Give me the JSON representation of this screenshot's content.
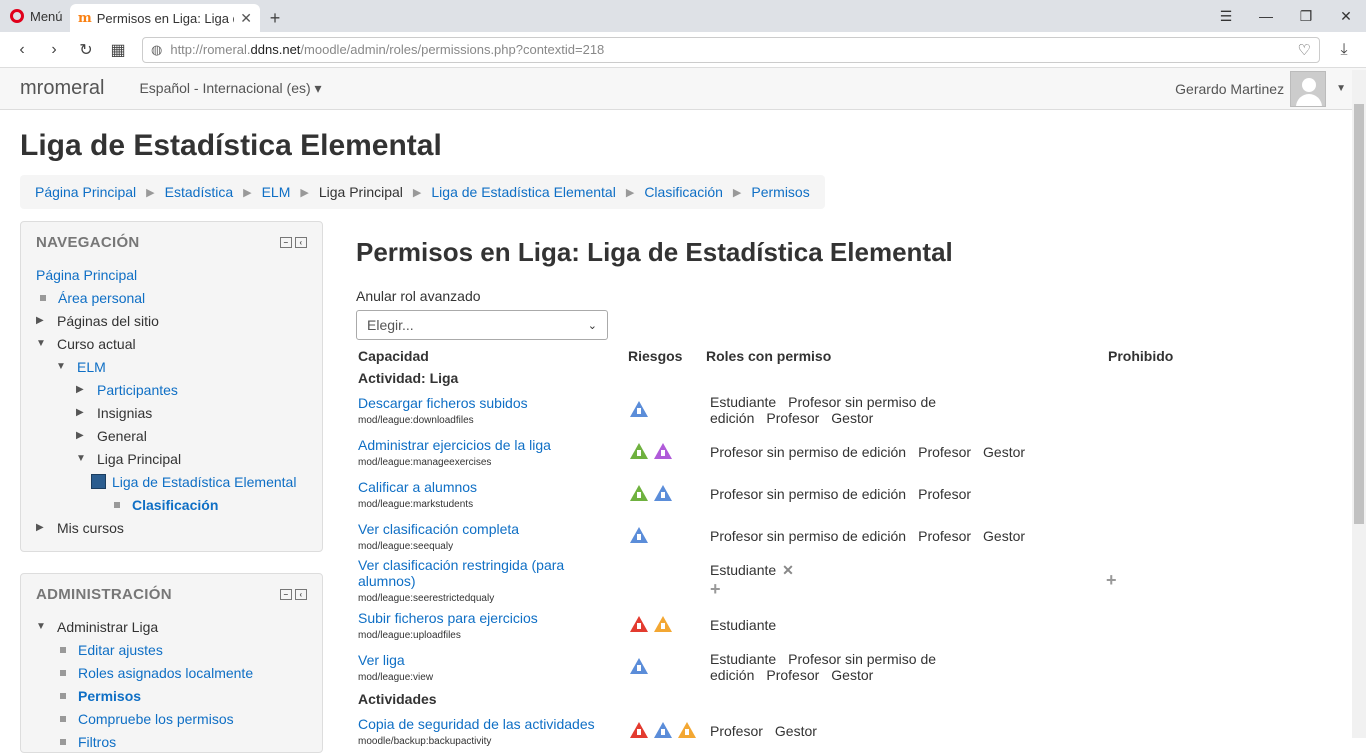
{
  "browser": {
    "menu_label": "Menú",
    "tab_title": "Permisos en Liga: Liga de E",
    "url_prefix": "http://romeral.",
    "url_domain": "ddns.net",
    "url_path": "/moodle/admin/roles/permissions.php?contextid=218"
  },
  "navbar": {
    "brand": "mromeral",
    "language": "Español - Internacional (es)",
    "user_name": "Gerardo Martinez"
  },
  "page_title": "Liga de Estadística Elemental",
  "breadcrumb": [
    "Página Principal",
    "Estadística",
    "ELM",
    "Liga Principal",
    "Liga de Estadística Elemental",
    "Clasificación",
    "Permisos"
  ],
  "navigation": {
    "title": "NAVEGACIÓN",
    "items": [
      "Página Principal",
      "Área personal",
      "Páginas del sitio",
      "Curso actual",
      "ELM",
      "Participantes",
      "Insignias",
      "General",
      "Liga Principal",
      "Liga de Estadística Elemental",
      "Clasificación",
      "Mis cursos"
    ]
  },
  "administration": {
    "title": "ADMINISTRACIÓN",
    "items": [
      "Administrar Liga",
      "Editar ajustes",
      "Roles asignados localmente",
      "Permisos",
      "Compruebe los permisos",
      "Filtros"
    ]
  },
  "main": {
    "heading": "Permisos en Liga: Liga de Estadística Elemental",
    "override_label": "Anular rol avanzado",
    "select_value": "Elegir...",
    "columns": [
      "Capacidad",
      "Riesgos",
      "Roles con permiso",
      "Prohibido"
    ],
    "section1": "Actividad: Liga",
    "section2": "Actividades",
    "rows": [
      {
        "name": "Descargar ficheros subidos",
        "code": "mod/league:downloadfiles",
        "roles": [
          "Estudiante",
          "Profesor sin permiso de edición",
          "Profesor",
          "Gestor"
        ]
      },
      {
        "name": "Administrar ejercicios de la liga",
        "code": "mod/league:manageexercises",
        "roles": [
          "Profesor sin permiso de edición",
          "Profesor",
          "Gestor"
        ]
      },
      {
        "name": "Calificar a alumnos",
        "code": "mod/league:markstudents",
        "roles": [
          "Profesor sin permiso de edición",
          "Profesor"
        ]
      },
      {
        "name": "Ver clasificación completa",
        "code": "mod/league:seequaly",
        "roles": [
          "Profesor sin permiso de edición",
          "Profesor",
          "Gestor"
        ]
      },
      {
        "name": "Ver clasificación restringida (para alumnos)",
        "code": "mod/league:seerestrictedqualy",
        "roles": [
          "Estudiante"
        ]
      },
      {
        "name": "Subir ficheros para ejercicios",
        "code": "mod/league:uploadfiles",
        "roles": [
          "Estudiante"
        ]
      },
      {
        "name": "Ver liga",
        "code": "mod/league:view",
        "roles": [
          "Estudiante",
          "Profesor sin permiso de edición",
          "Profesor",
          "Gestor"
        ]
      },
      {
        "name": "Copia de seguridad de las actividades",
        "code": "moodle/backup:backupactivity",
        "roles": [
          "Profesor",
          "Gestor"
        ]
      }
    ]
  }
}
